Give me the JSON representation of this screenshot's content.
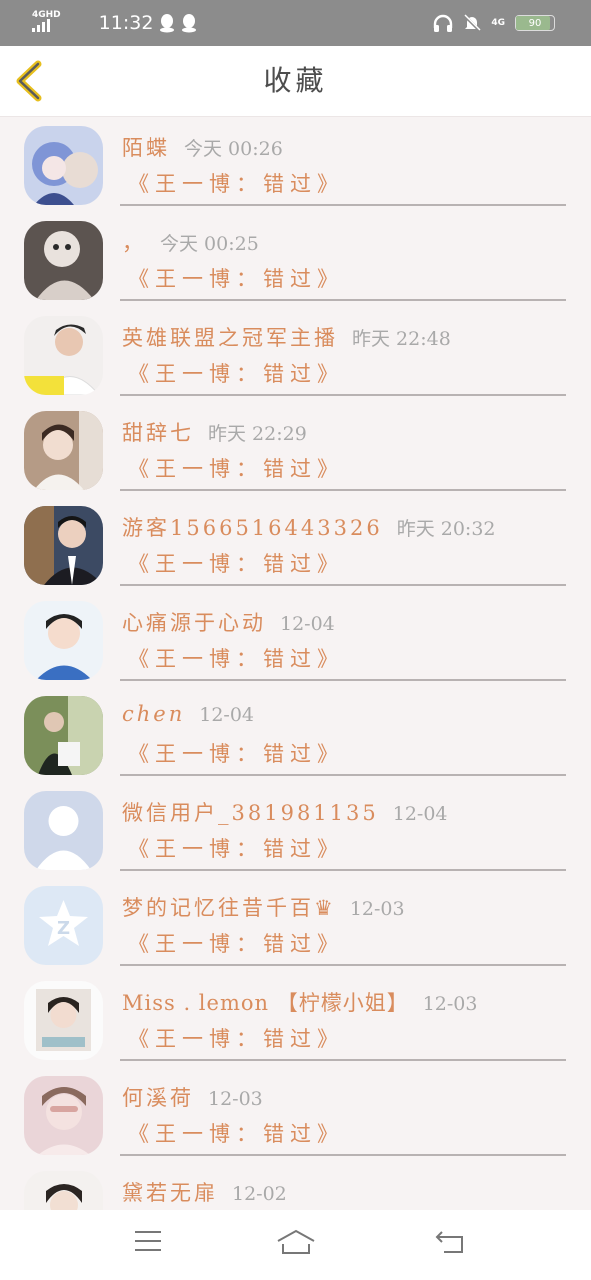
{
  "status_bar": {
    "network": "4GHD",
    "time": "11:32",
    "network_right": "4G",
    "battery": "90",
    "icons": [
      "signal-icon",
      "qq-icon",
      "qq-icon",
      "headphones-icon",
      "mute-icon",
      "battery-icon"
    ]
  },
  "header": {
    "title": "收藏",
    "back_icon": "chevron-left-icon"
  },
  "items": [
    {
      "name": "陌蝶",
      "time": "今天 00:26",
      "content": "《王一博：错过》",
      "avatar": "anime-avatar"
    },
    {
      "name": "，",
      "time": "今天 00:25",
      "content": "《王一博：错过》",
      "avatar": "cat-avatar"
    },
    {
      "name": "英雄联盟之冠军主播",
      "time": "昨天 22:48",
      "content": "《王一博：错过》",
      "avatar": "boy-avatar"
    },
    {
      "name": "甜辞七",
      "time": "昨天 22:29",
      "content": "《王一博：错过》",
      "avatar": "girl-avatar"
    },
    {
      "name": "游客1566516443326",
      "time": "昨天 20:32",
      "content": "《王一博：错过》",
      "avatar": "suit-avatar"
    },
    {
      "name": "心痛源于心动",
      "time": "12-04",
      "content": "《王一博：错过》",
      "avatar": "child-avatar"
    },
    {
      "name": "chen",
      "time": "12-04",
      "content": "《王一博：错过》",
      "avatar": "outdoor-avatar"
    },
    {
      "name": "微信用户_381981135",
      "time": "12-04",
      "content": "《王一博：错过》",
      "avatar": "default-avatar"
    },
    {
      "name": "梦的记忆往昔千百♛",
      "time": "12-03",
      "content": "《王一博：错过》",
      "avatar": "qzone-avatar"
    },
    {
      "name": "Miss . lemon 【柠檬小姐】",
      "time": "12-03",
      "content": "《王一博：错过》",
      "avatar": "lemon-avatar"
    },
    {
      "name": "何溪荷",
      "time": "12-03",
      "content": "《王一博：错过》",
      "avatar": "pink-avatar"
    },
    {
      "name": "黛若无扉",
      "time": "12-02",
      "content": "",
      "avatar": "partial-avatar"
    }
  ],
  "nav": {
    "icons": [
      "menu-icon",
      "home-icon",
      "back-icon"
    ]
  }
}
